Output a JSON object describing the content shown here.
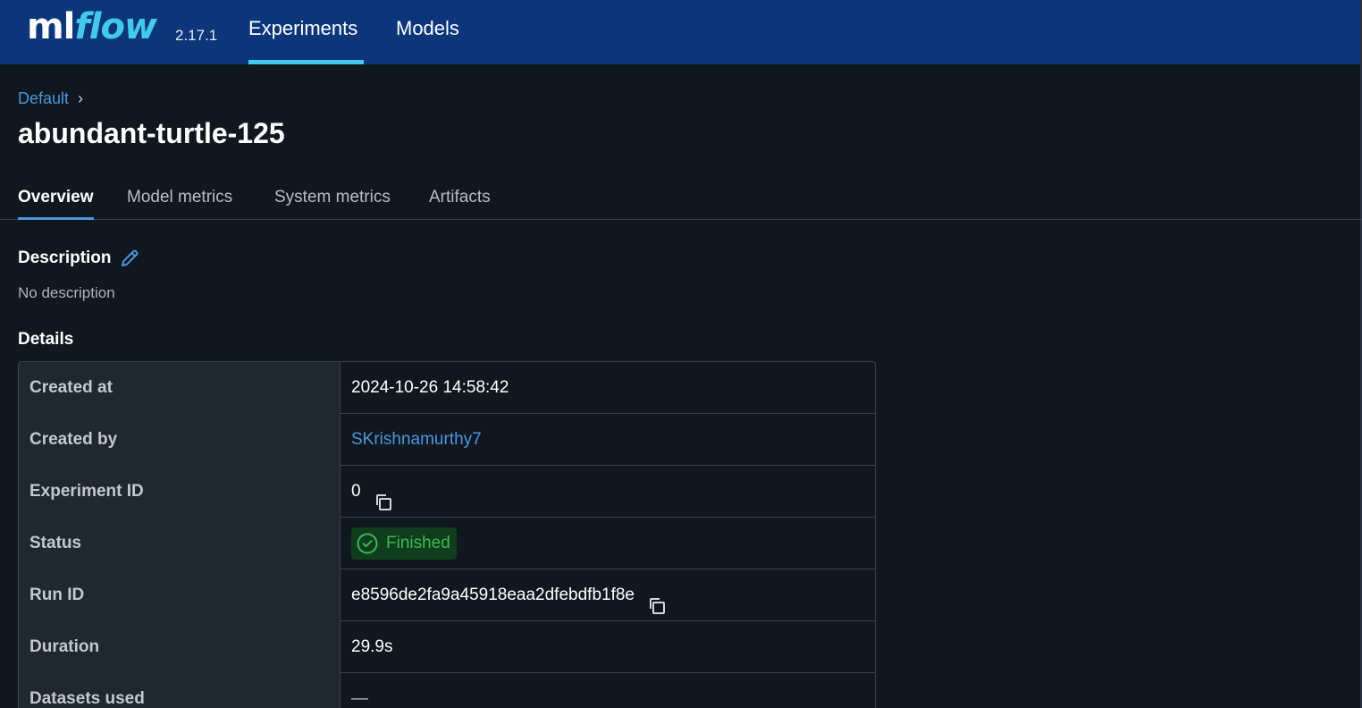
{
  "header": {
    "logo_ml": "ml",
    "logo_flow": "flow",
    "version": "2.17.1",
    "nav": [
      "Experiments",
      "Models"
    ],
    "active_nav": "Experiments"
  },
  "breadcrumb": {
    "parent": "Default",
    "separator": "›"
  },
  "page_title": "abundant-turtle-125",
  "tabs": [
    {
      "label": "Overview",
      "active": true
    },
    {
      "label": "Model metrics",
      "active": false
    },
    {
      "label": "System metrics",
      "active": false
    },
    {
      "label": "Artifacts",
      "active": false
    }
  ],
  "description": {
    "title": "Description",
    "text": "No description"
  },
  "details": {
    "title": "Details",
    "rows": [
      {
        "label": "Created at",
        "value": "2024-10-26 14:58:42"
      },
      {
        "label": "Created by",
        "value": "SKrishnamurthy7"
      },
      {
        "label": "Experiment ID",
        "value": "0"
      },
      {
        "label": "Status",
        "value": "Finished"
      },
      {
        "label": "Run ID",
        "value": "e8596de2fa9a45918eaa2dfebdfb1f8e"
      },
      {
        "label": "Duration",
        "value": "29.9s"
      },
      {
        "label": "Datasets used",
        "value": "—"
      }
    ]
  },
  "colors": {
    "header_bg": "#0c3679",
    "accent": "#43c9ed",
    "link": "#4b96dd",
    "status_success": "#3fb950"
  },
  "icons": [
    "edit-icon",
    "copy-icon",
    "check-circle-icon"
  ]
}
